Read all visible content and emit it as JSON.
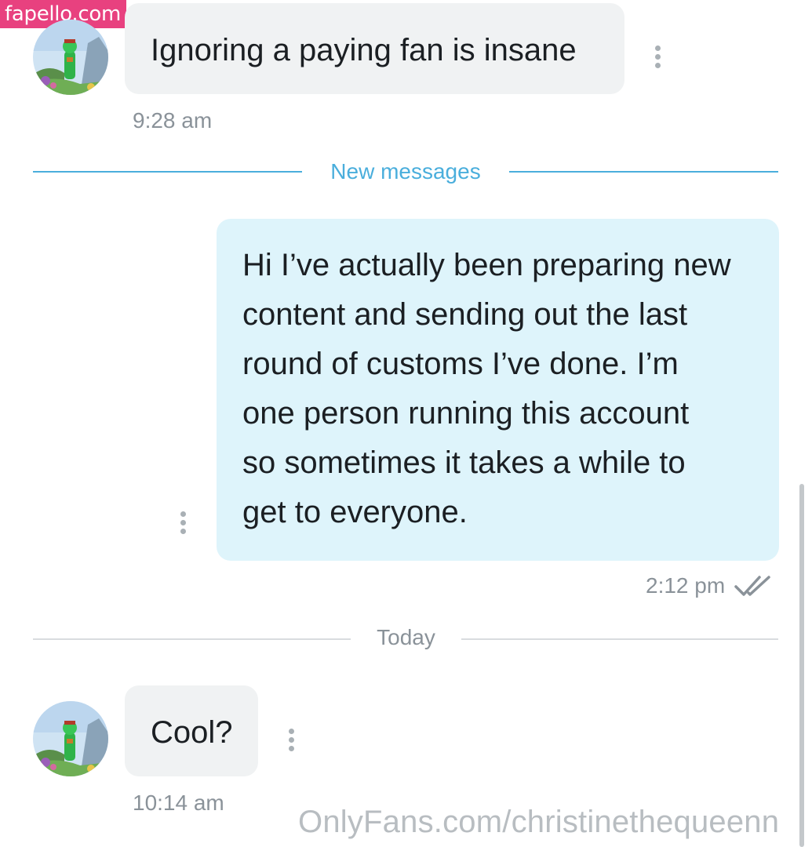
{
  "watermark": {
    "badge_text": "fapello.com",
    "footer_text": "OnlyFans.com/christinethequeenn"
  },
  "colors": {
    "badge": "#e8417f",
    "incoming_bubble": "#f0f2f3",
    "outgoing_bubble": "#def4fb",
    "new_messages_divider": "#4aaedc",
    "today_divider": "#8a9299"
  },
  "messages": [
    {
      "direction": "incoming",
      "text": "Ignoring a paying fan is insane",
      "time": "9:28 am"
    },
    {
      "direction": "outgoing",
      "text": "Hi I’ve actually been preparing new\ncontent and sending out the last\nround of customs I’ve done. I’m\none person running this account\nso sometimes it takes a while to\nget to everyone.",
      "time": "2:12 pm",
      "status_icon": "double-check-icon"
    },
    {
      "direction": "incoming",
      "text": "Cool?",
      "time": "10:14 am"
    }
  ],
  "dividers": {
    "new_messages": "New messages",
    "today": "Today"
  },
  "icons": {
    "menu": "more-vertical-icon",
    "read_status": "double-check-icon",
    "avatar": "avatar-image"
  }
}
